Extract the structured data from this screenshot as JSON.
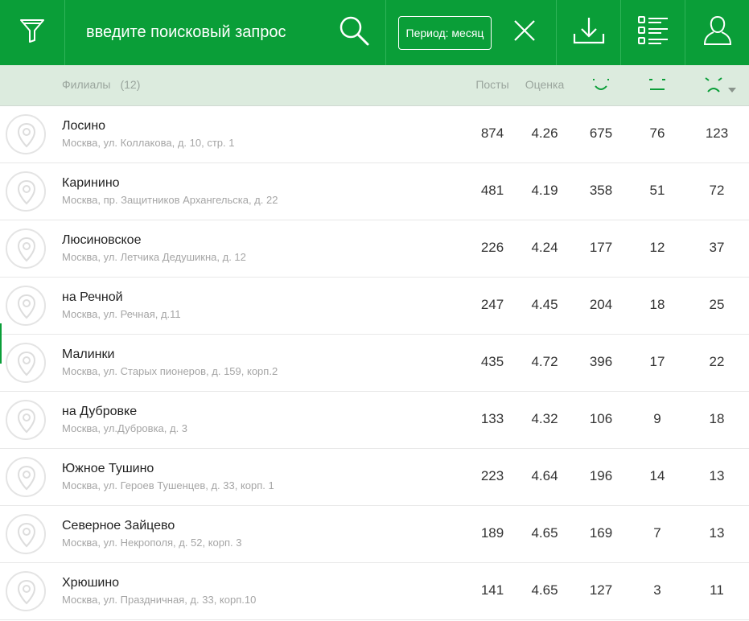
{
  "toolbar": {
    "search_placeholder": "введите поисковый запрос",
    "period_label": "Период: месяц",
    "accent": "#0a9e38"
  },
  "icons": {
    "filter": "filter-icon",
    "search": "search-icon",
    "close": "close-icon",
    "download": "download-icon",
    "list": "list-icon",
    "user": "user-icon",
    "pin": "location-pin-icon"
  },
  "table": {
    "title": "Филиалы",
    "count": "(12)",
    "columns": {
      "posts": "Посты",
      "score": "Оценка"
    },
    "rows": [
      {
        "name": "Лосино",
        "address": "Москва, ул. Коллакова, д. 10, стр. 1",
        "posts": "874",
        "score": "4.26",
        "positive": "675",
        "neutral": "76",
        "negative": "123"
      },
      {
        "name": "Каринино",
        "address": "Москва, пр. Защитников Архангельска, д. 22",
        "posts": "481",
        "score": "4.19",
        "positive": "358",
        "neutral": "51",
        "negative": "72"
      },
      {
        "name": "Люсиновское",
        "address": "Москва, ул. Летчика Дедушикна, д. 12",
        "posts": "226",
        "score": "4.24",
        "positive": "177",
        "neutral": "12",
        "negative": "37"
      },
      {
        "name": "на Речной",
        "address": "Москва, ул. Речная, д.11",
        "posts": "247",
        "score": "4.45",
        "positive": "204",
        "neutral": "18",
        "negative": "25"
      },
      {
        "name": "Малинки",
        "address": "Москва, ул. Старых пионеров, д. 159, корп.2",
        "posts": "435",
        "score": "4.72",
        "positive": "396",
        "neutral": "17",
        "negative": "22"
      },
      {
        "name": "на Дубровке",
        "address": "Москва, ул.Дубровка, д. 3",
        "posts": "133",
        "score": "4.32",
        "positive": "106",
        "neutral": "9",
        "negative": "18"
      },
      {
        "name": "Южное Тушино",
        "address": "Москва, ул. Героев Тушенцев, д. 33, корп. 1",
        "posts": "223",
        "score": "4.64",
        "positive": "196",
        "neutral": "14",
        "negative": "13"
      },
      {
        "name": "Северное Зайцево",
        "address": "Москва, ул. Некрополя, д. 52, корп. 3",
        "posts": "189",
        "score": "4.65",
        "positive": "169",
        "neutral": "7",
        "negative": "13"
      },
      {
        "name": "Хрюшино",
        "address": "Москва, ул. Праздничная, д. 33, корп.10",
        "posts": "141",
        "score": "4.65",
        "positive": "127",
        "neutral": "3",
        "negative": "11"
      }
    ]
  }
}
